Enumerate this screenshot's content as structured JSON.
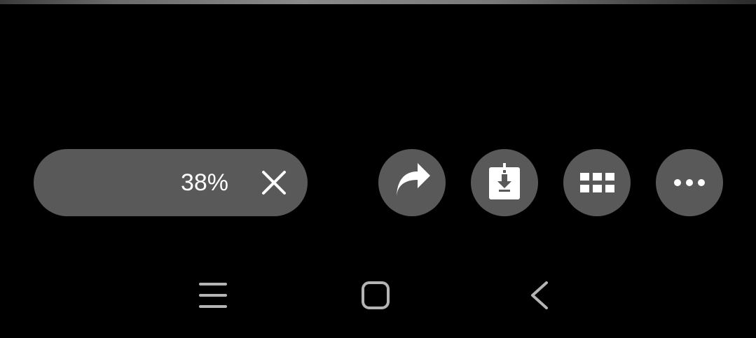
{
  "download": {
    "progress_label": "38%",
    "progress_value": 0.38
  },
  "actions": {
    "share_icon": "share-arrow-icon",
    "download_icon": "download-icon",
    "grid_icon": "grid-icon",
    "more_icon": "more-dots-icon",
    "close_icon": "close-icon"
  },
  "nav": {
    "recents_icon": "recents-icon",
    "home_icon": "home-icon",
    "back_icon": "back-icon"
  },
  "colors": {
    "background": "#000000",
    "button_fill": "#595959",
    "icon": "#ffffff",
    "nav_icon": "#b4b4b4"
  }
}
